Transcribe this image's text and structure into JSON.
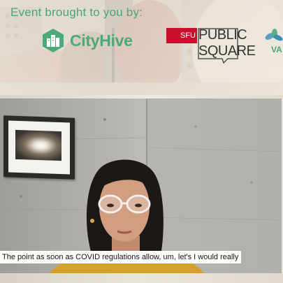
{
  "banner": {
    "title": "Event brought to you by:",
    "sponsors": [
      {
        "name": "CityHive"
      },
      {
        "name": "SFU",
        "line1": "PUBLIC",
        "line2": "SQUARE"
      },
      {
        "name": "VA"
      }
    ]
  },
  "video": {
    "caption": "The point as soon as COVID regulations allow, um, let's I would really"
  },
  "colors": {
    "brand_green": "#4caa79",
    "sfu_red": "#c8102e",
    "caption_bg": "#ffffff"
  }
}
